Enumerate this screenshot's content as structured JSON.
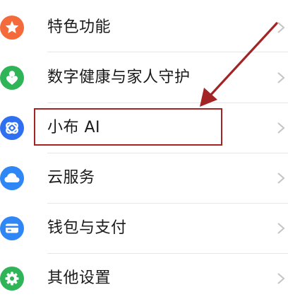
{
  "settings_list": {
    "items": [
      {
        "label": "特色功能",
        "icon": "star-icon",
        "color": "#f56a3a"
      },
      {
        "label": "数字健康与家人守护",
        "icon": "person-heart-icon",
        "color": "#2fb457"
      },
      {
        "label": "小布 AI",
        "icon": "ai-assistant-icon",
        "color": "#2f6ff2"
      },
      {
        "label": "云服务",
        "icon": "cloud-icon",
        "color": "#2f86f5"
      },
      {
        "label": "钱包与支付",
        "icon": "wallet-icon",
        "color": "#2f86f5"
      },
      {
        "label": "其他设置",
        "icon": "gear-icon",
        "color": "#2fb457"
      }
    ]
  },
  "annotation": {
    "highlight_color": "#a32424",
    "highlight_target": "小布 AI"
  }
}
